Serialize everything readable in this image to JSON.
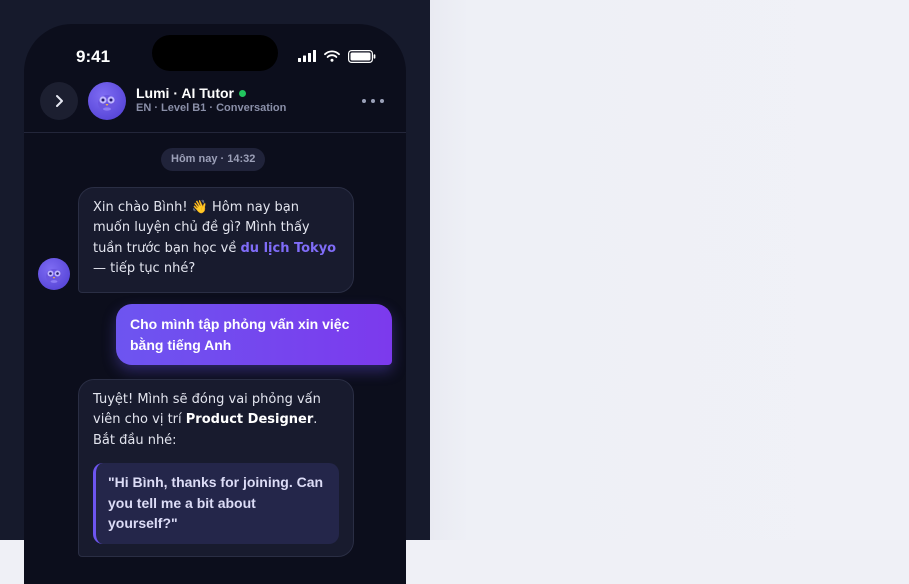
{
  "status_bar": {
    "time": "9:41"
  },
  "header": {
    "back_icon": "chevron-right-icon",
    "tutor_name": "Lumi · AI Tutor",
    "online": true,
    "subtitle": "EN · Level B1 · Conversation",
    "more_icon": "more-horizontal-icon"
  },
  "chat": {
    "date_label": "Hôm nay · 14:32",
    "messages": [
      {
        "sender": "ai",
        "text_before": "Xin chào Bình! 👋 Hôm nay bạn muốn luyện chủ đề gì? Mình thấy tuần trước bạn học về ",
        "highlight": "du lịch Tokyo",
        "text_after": " — tiếp tục nhé?"
      },
      {
        "sender": "user",
        "text": "Cho mình tập phỏng vấn xin việc bằng tiếng Anh"
      },
      {
        "sender": "ai",
        "text_before": "Tuyệt! Mình sẽ đóng vai phỏng vấn viên cho vị trí ",
        "strong": "Product Designer",
        "text_after": ". Bắt đầu nhé:",
        "quote": "\"Hi Bình, thanks for joining. Can you tell me a bit about yourself?\""
      }
    ]
  },
  "colors": {
    "accent": "#6d55f0",
    "accent_alt": "#7c3aed",
    "online": "#22c55e",
    "background": "#0c0e1c"
  }
}
